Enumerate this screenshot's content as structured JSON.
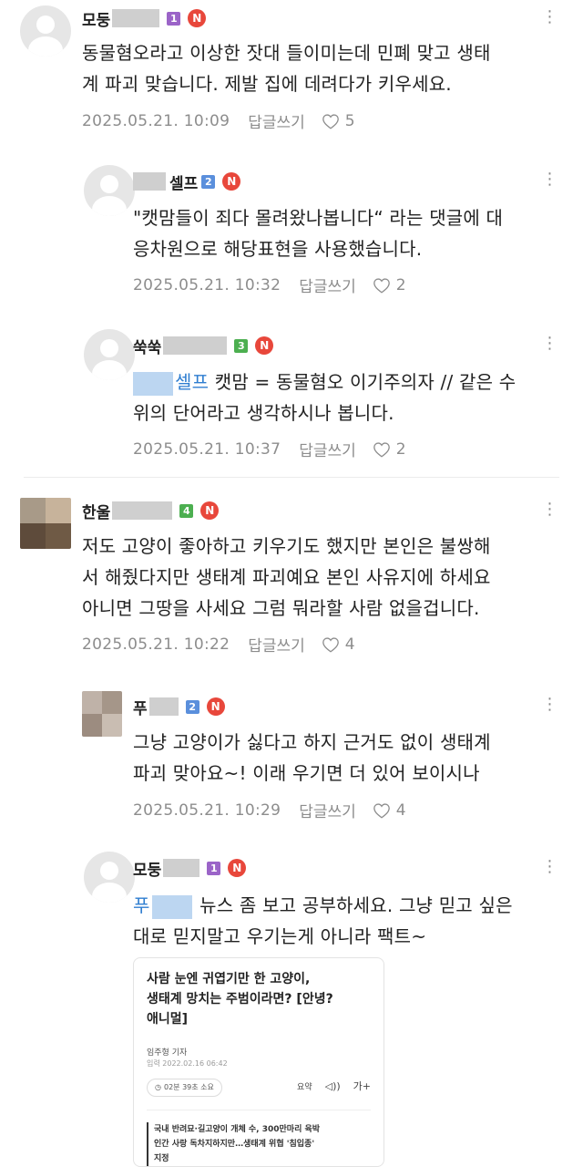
{
  "colors": {
    "accent_red": "#e8473b",
    "mention_blue": "#2f7ed0",
    "meta_gray": "#8d8d8d",
    "level_purple": "#9b64c8",
    "level_blue": "#5a8fdc",
    "level_green": "#4caf50"
  },
  "icons": {
    "more": "more-vertical-dots-icon",
    "like": "heart-outline-icon",
    "new_badge": "N"
  },
  "comments": [
    {
      "nick": "모둥",
      "level": "1",
      "badge": "N",
      "lines": [
        "동물혐오라고 이상한 잣대 들이미는데 민폐 맞고 생태",
        "계 파괴 맞습니다. 제발 집에 데려다가 키우세요."
      ],
      "date": "2025.05.21. 10:09",
      "reply_label": "답글쓰기",
      "likes": "5"
    },
    {
      "nick": "셀프",
      "level": "2",
      "badge": "N",
      "lines": [
        "\"캣맘들이 죄다 몰려왔나봅니다“ 라는 댓글에 대",
        "응차원으로 해당표현을 사용했습니다."
      ],
      "date": "2025.05.21. 10:32",
      "reply_label": "답글쓰기",
      "likes": "2"
    },
    {
      "nick": "쑥쑥",
      "level": "3",
      "badge": "N",
      "mention": "셀프",
      "lines": [
        " 캣맘 = 동물혐오 이기주의자 // 같은 수",
        "위의 단어라고 생각하시나 봅니다."
      ],
      "date": "2025.05.21. 10:37",
      "reply_label": "답글쓰기",
      "likes": "2"
    },
    {
      "nick": "한울",
      "level": "4",
      "badge": "N",
      "lines": [
        "저도 고양이 좋아하고 키우기도 했지만 본인은 불쌍해",
        "서 해줬다지만 생태계 파괴예요 본인 사유지에 하세요",
        "아니면 그땅을 사세요 그럼 뭐라할 사람 없을겁니다."
      ],
      "date": "2025.05.21. 10:22",
      "reply_label": "답글쓰기",
      "likes": "4"
    },
    {
      "nick": "푸",
      "level": "2",
      "badge": "N",
      "lines": [
        "그냥 고양이가 싫다고 하지 근거도 없이 생태계",
        "파괴 맞아요~! 이래 우기면 더 있어 보이시나"
      ],
      "date": "2025.05.21. 10:29",
      "reply_label": "답글쓰기",
      "likes": "4"
    },
    {
      "nick": "모둥",
      "level": "1",
      "badge": "N",
      "mention": "푸",
      "lines": [
        " 뉴스 좀 보고 공부하세요. 그냥 믿고 싶은",
        "대로 믿지말고 우기는게 아니라 팩트~"
      ]
    }
  ],
  "news": {
    "title_lines": [
      "사람 눈엔 귀엽기만 한 고양이,",
      "생태계 망치는 주범이라면? [안녕?",
      "애니멀]"
    ],
    "author": "임주형 기자",
    "published": "입력 2022.02.16 06:42",
    "read_time": "02분 39초 소요",
    "tools": [
      "요약",
      "◁))",
      "가+"
    ],
    "summary_lines": [
      "국내 반려묘·길고양이 개체 수, 300만마리 육박",
      "인간 사랑 독차지하지만…생태계 위협 '침입종'",
      "지정"
    ]
  }
}
